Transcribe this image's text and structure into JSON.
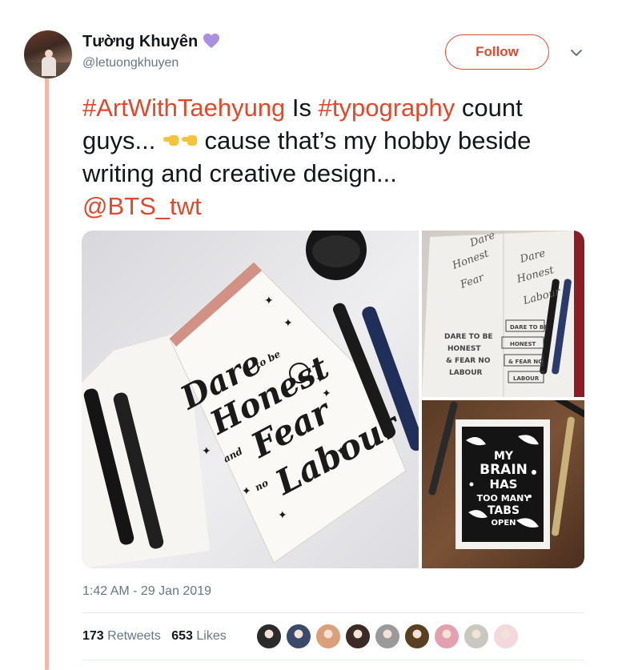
{
  "user": {
    "display_name": "Tường Khuyên",
    "handle": "@letuongkhuyen",
    "badge_icon": "purple-heart-icon",
    "badge_color": "#ab8fe0"
  },
  "follow_label": "Follow",
  "accent_color": "#e0492b",
  "tweet": {
    "hashtag1": "#ArtWithTaehyung",
    "text1": " Is ",
    "hashtag2": "#typography",
    "text2": " count guys... ",
    "emoji": "backhand-index-pointing-right-icon",
    "text3": " cause that’s my hobby beside writing and creative design...",
    "mention": "@BTS_twt"
  },
  "media": {
    "main_lines": [
      "Dare",
      "to be",
      "Honest",
      "and",
      "Fear",
      "no",
      "Labour"
    ],
    "top_lines": [
      "DARE TO BE",
      "HONEST",
      "& FEAR NO",
      "LABOUR"
    ],
    "bottom_lines": [
      "MY",
      "BRAIN",
      "HAS",
      "TOO MANY",
      "TABS",
      "OPEN"
    ]
  },
  "timestamp": "1:42 AM - 29 Jan 2019",
  "stats": {
    "retweets_count": "173",
    "retweets_label": "Retweets",
    "likes_count": "653",
    "likes_label": "Likes"
  },
  "likers": [
    "#2b2b2b",
    "#3a4a6a",
    "#d9a07a",
    "#3b2a26",
    "#9a9a9a",
    "#5a4020",
    "#e2a0b0",
    "#c8c8c0",
    "#f3d8de"
  ]
}
